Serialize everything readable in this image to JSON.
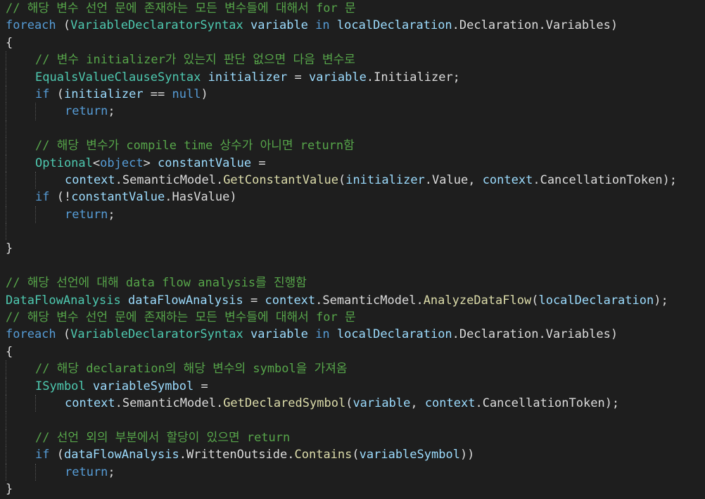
{
  "code_lines": [
    {
      "indent": 0,
      "tokens": [
        {
          "t": "comment",
          "v": "// 해당 변수 선언 문에 존재하는 모든 변수들에 대해서 for 문"
        }
      ]
    },
    {
      "indent": 0,
      "tokens": [
        {
          "t": "keyword",
          "v": "foreach"
        },
        {
          "t": "plain",
          "v": " ("
        },
        {
          "t": "type",
          "v": "VariableDeclaratorSyntax"
        },
        {
          "t": "plain",
          "v": " "
        },
        {
          "t": "ident",
          "v": "variable"
        },
        {
          "t": "plain",
          "v": " "
        },
        {
          "t": "keyword",
          "v": "in"
        },
        {
          "t": "plain",
          "v": " "
        },
        {
          "t": "ident",
          "v": "localDeclaration"
        },
        {
          "t": "plain",
          "v": ".Declaration.Variables)"
        }
      ]
    },
    {
      "indent": 0,
      "tokens": [
        {
          "t": "plain",
          "v": "{"
        }
      ]
    },
    {
      "indent": 1,
      "tokens": [
        {
          "t": "comment",
          "v": "// 변수 initializer가 있는지 판단 없으면 다음 변수로"
        }
      ]
    },
    {
      "indent": 1,
      "tokens": [
        {
          "t": "type",
          "v": "EqualsValueClauseSyntax"
        },
        {
          "t": "plain",
          "v": " "
        },
        {
          "t": "ident",
          "v": "initializer"
        },
        {
          "t": "plain",
          "v": " = "
        },
        {
          "t": "ident",
          "v": "variable"
        },
        {
          "t": "plain",
          "v": ".Initializer;"
        }
      ]
    },
    {
      "indent": 1,
      "tokens": [
        {
          "t": "keyword",
          "v": "if"
        },
        {
          "t": "plain",
          "v": " ("
        },
        {
          "t": "ident",
          "v": "initializer"
        },
        {
          "t": "plain",
          "v": " == "
        },
        {
          "t": "keyword",
          "v": "null"
        },
        {
          "t": "plain",
          "v": ")"
        }
      ]
    },
    {
      "indent": 2,
      "tokens": [
        {
          "t": "keyword",
          "v": "return"
        },
        {
          "t": "plain",
          "v": ";"
        }
      ]
    },
    {
      "indent": 1,
      "tokens": []
    },
    {
      "indent": 1,
      "tokens": [
        {
          "t": "comment",
          "v": "// 해당 변수가 compile time 상수가 아니면 return함"
        }
      ]
    },
    {
      "indent": 1,
      "tokens": [
        {
          "t": "type",
          "v": "Optional"
        },
        {
          "t": "plain",
          "v": "<"
        },
        {
          "t": "keyword",
          "v": "object"
        },
        {
          "t": "plain",
          "v": "> "
        },
        {
          "t": "ident",
          "v": "constantValue"
        },
        {
          "t": "plain",
          "v": " ="
        }
      ]
    },
    {
      "indent": 2,
      "tokens": [
        {
          "t": "ident",
          "v": "context"
        },
        {
          "t": "plain",
          "v": ".SemanticModel."
        },
        {
          "t": "method",
          "v": "GetConstantValue"
        },
        {
          "t": "plain",
          "v": "("
        },
        {
          "t": "ident",
          "v": "initializer"
        },
        {
          "t": "plain",
          "v": ".Value, "
        },
        {
          "t": "ident",
          "v": "context"
        },
        {
          "t": "plain",
          "v": ".CancellationToken);"
        }
      ]
    },
    {
      "indent": 1,
      "tokens": [
        {
          "t": "keyword",
          "v": "if"
        },
        {
          "t": "plain",
          "v": " (!"
        },
        {
          "t": "ident",
          "v": "constantValue"
        },
        {
          "t": "plain",
          "v": ".HasValue)"
        }
      ]
    },
    {
      "indent": 2,
      "tokens": [
        {
          "t": "keyword",
          "v": "return"
        },
        {
          "t": "plain",
          "v": ";"
        }
      ]
    },
    {
      "indent": 1,
      "tokens": []
    },
    {
      "indent": 0,
      "tokens": [
        {
          "t": "plain",
          "v": "}"
        }
      ]
    },
    {
      "indent": 0,
      "tokens": []
    },
    {
      "indent": 0,
      "tokens": [
        {
          "t": "comment",
          "v": "// 해당 선언에 대해 data flow analysis를 진행함"
        }
      ]
    },
    {
      "indent": 0,
      "tokens": [
        {
          "t": "type",
          "v": "DataFlowAnalysis"
        },
        {
          "t": "plain",
          "v": " "
        },
        {
          "t": "ident",
          "v": "dataFlowAnalysis"
        },
        {
          "t": "plain",
          "v": " = "
        },
        {
          "t": "ident",
          "v": "context"
        },
        {
          "t": "plain",
          "v": ".SemanticModel."
        },
        {
          "t": "method",
          "v": "AnalyzeDataFlow"
        },
        {
          "t": "plain",
          "v": "("
        },
        {
          "t": "ident",
          "v": "localDeclaration"
        },
        {
          "t": "plain",
          "v": ");"
        }
      ]
    },
    {
      "indent": 0,
      "tokens": [
        {
          "t": "comment",
          "v": "// 해당 변수 선언 문에 존재하는 모든 변수들에 대해서 for 문"
        }
      ]
    },
    {
      "indent": 0,
      "tokens": [
        {
          "t": "keyword",
          "v": "foreach"
        },
        {
          "t": "plain",
          "v": " ("
        },
        {
          "t": "type",
          "v": "VariableDeclaratorSyntax"
        },
        {
          "t": "plain",
          "v": " "
        },
        {
          "t": "ident",
          "v": "variable"
        },
        {
          "t": "plain",
          "v": " "
        },
        {
          "t": "keyword",
          "v": "in"
        },
        {
          "t": "plain",
          "v": " "
        },
        {
          "t": "ident",
          "v": "localDeclaration"
        },
        {
          "t": "plain",
          "v": ".Declaration.Variables)"
        }
      ]
    },
    {
      "indent": 0,
      "tokens": [
        {
          "t": "plain",
          "v": "{"
        }
      ]
    },
    {
      "indent": 1,
      "tokens": [
        {
          "t": "comment",
          "v": "// 해당 declaration의 해당 변수의 symbol을 가져옴"
        }
      ]
    },
    {
      "indent": 1,
      "tokens": [
        {
          "t": "type",
          "v": "ISymbol"
        },
        {
          "t": "plain",
          "v": " "
        },
        {
          "t": "ident",
          "v": "variableSymbol"
        },
        {
          "t": "plain",
          "v": " ="
        }
      ]
    },
    {
      "indent": 2,
      "tokens": [
        {
          "t": "ident",
          "v": "context"
        },
        {
          "t": "plain",
          "v": ".SemanticModel."
        },
        {
          "t": "method",
          "v": "GetDeclaredSymbol"
        },
        {
          "t": "plain",
          "v": "("
        },
        {
          "t": "ident",
          "v": "variable"
        },
        {
          "t": "plain",
          "v": ", "
        },
        {
          "t": "ident",
          "v": "context"
        },
        {
          "t": "plain",
          "v": ".CancellationToken);"
        }
      ]
    },
    {
      "indent": 1,
      "tokens": []
    },
    {
      "indent": 1,
      "tokens": [
        {
          "t": "comment",
          "v": "// 선언 외의 부분에서 할당이 있으면 return"
        }
      ]
    },
    {
      "indent": 1,
      "tokens": [
        {
          "t": "keyword",
          "v": "if"
        },
        {
          "t": "plain",
          "v": " ("
        },
        {
          "t": "ident",
          "v": "dataFlowAnalysis"
        },
        {
          "t": "plain",
          "v": ".WrittenOutside."
        },
        {
          "t": "method",
          "v": "Contains"
        },
        {
          "t": "plain",
          "v": "("
        },
        {
          "t": "ident",
          "v": "variableSymbol"
        },
        {
          "t": "plain",
          "v": "))"
        }
      ]
    },
    {
      "indent": 2,
      "tokens": [
        {
          "t": "keyword",
          "v": "return"
        },
        {
          "t": "plain",
          "v": ";"
        }
      ]
    },
    {
      "indent": 0,
      "tokens": [
        {
          "t": "plain",
          "v": "}"
        }
      ]
    }
  ],
  "colors": {
    "background": "#1e1e1e",
    "comment": "#57a64a",
    "keyword": "#569cd6",
    "type": "#4ec9b0",
    "method": "#dcdcaa",
    "identifier": "#9cdcfe",
    "text": "#dcdcdc"
  }
}
